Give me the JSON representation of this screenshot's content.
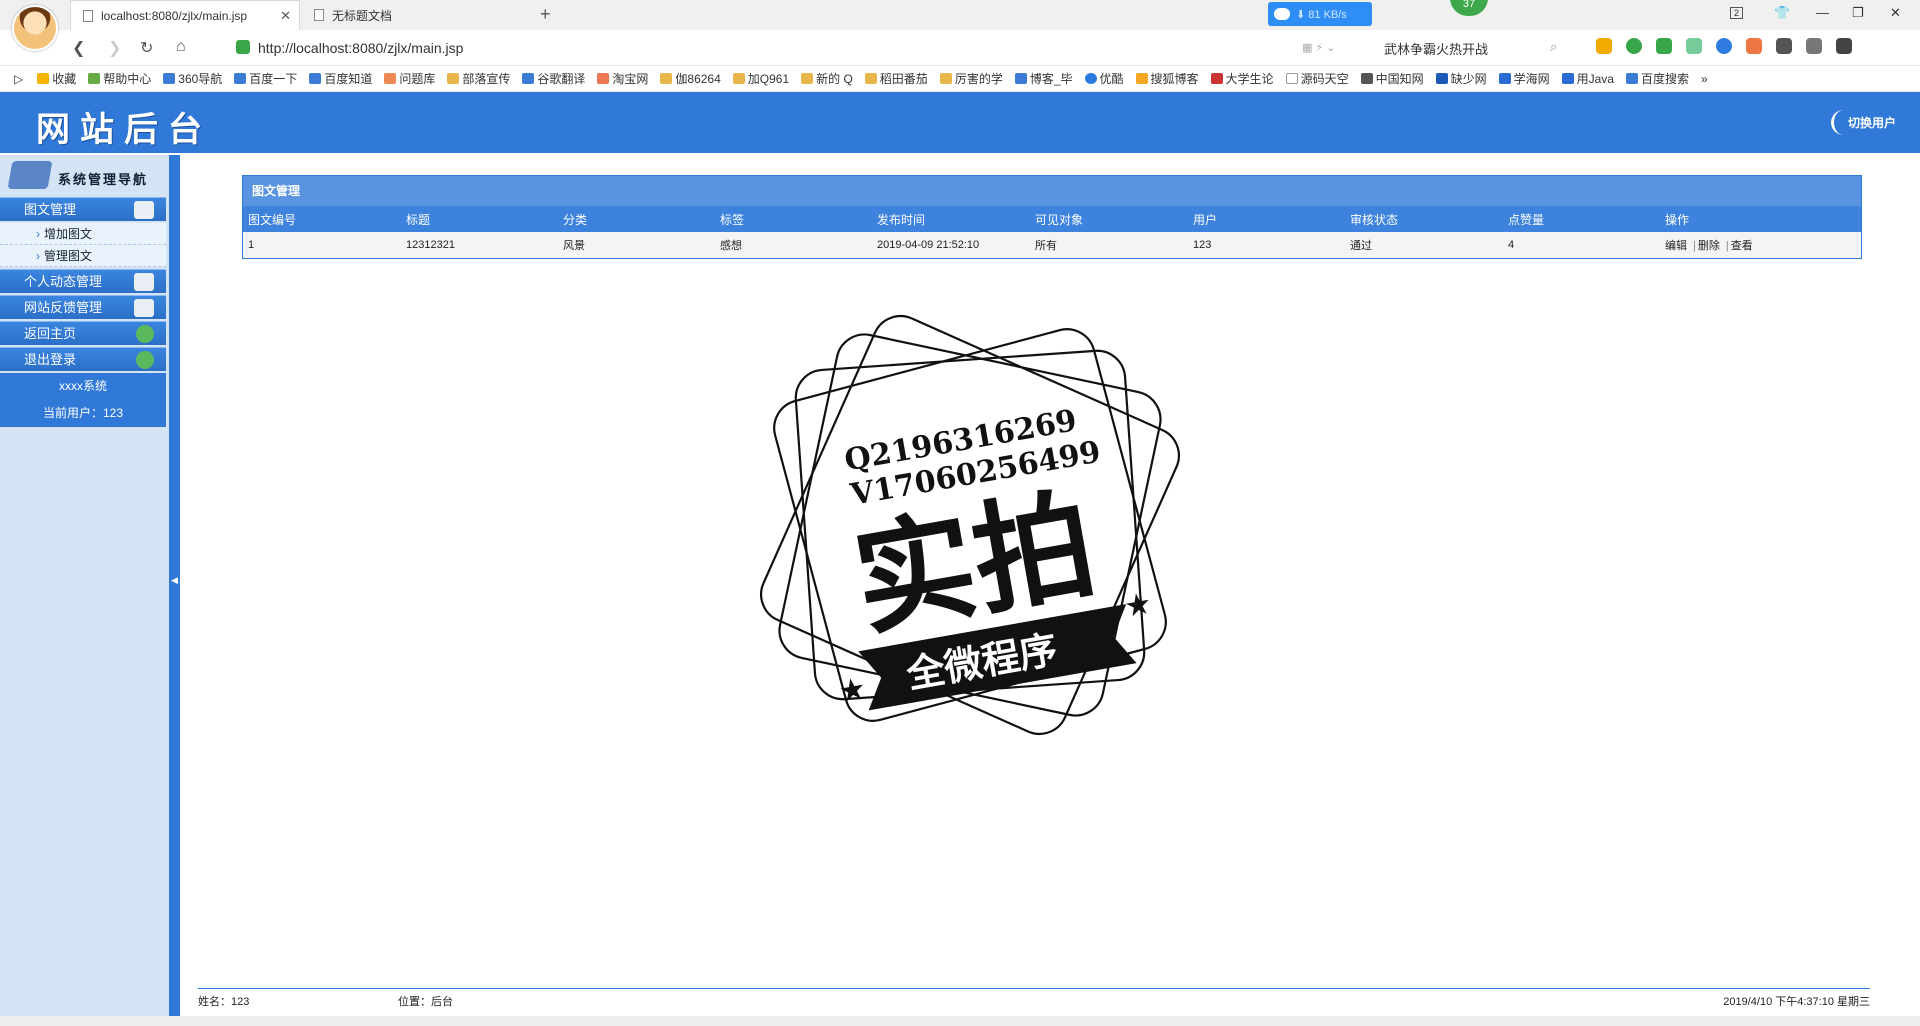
{
  "browser": {
    "tabs": [
      {
        "label": "localhost:8080/zjlx/main.jsp",
        "active": true
      },
      {
        "label": "无标题文档",
        "active": false
      }
    ],
    "download_speed": "81 KB/s",
    "notification_count": "37",
    "window_tab_count": "2",
    "address": "http://localhost:8080/zjlx/main.jsp",
    "search_text": "武林争霸火热开战",
    "bookmarks": [
      "收藏",
      "帮助中心",
      "360导航",
      "百度一下",
      "百度知道",
      "问题库",
      "部落宣传",
      "谷歌翻译",
      "淘宝网",
      "伽86264",
      "加Q961",
      "新的 Q",
      "稻田番茄",
      "厉害的学",
      "博客_毕",
      "优酷",
      "搜狐博客",
      "大学生论",
      "源码天空",
      "中国知网",
      "缺少网",
      "学海网",
      "用Java",
      "百度搜索"
    ]
  },
  "site": {
    "title": "网站后台",
    "switch_user": "切换用户"
  },
  "sidebar": {
    "title": "系统管理导航",
    "menus": [
      {
        "label": "图文管理",
        "icon": "edit-icon",
        "children": [
          "增加图文",
          "管理图文"
        ]
      },
      {
        "label": "个人动态管理",
        "icon": "edit-icon",
        "children": []
      },
      {
        "label": "网站反馈管理",
        "icon": "edit-icon",
        "children": []
      },
      {
        "label": "返回主页",
        "icon": "refresh-arrow-icon",
        "children": []
      },
      {
        "label": "退出登录",
        "icon": "exit-icon",
        "children": []
      }
    ],
    "system_name": "xxxx系统",
    "current_user": "当前用户：123"
  },
  "panel": {
    "title": "图文管理",
    "columns": [
      "图文编号",
      "标题",
      "分类",
      "标签",
      "发布时间",
      "可见对象",
      "用户",
      "审核状态",
      "点赞量",
      "操作"
    ],
    "rows": [
      {
        "id": "1",
        "title": "12312321",
        "category": "风景",
        "tag": "感想",
        "time": "2019-04-09 21:52:10",
        "visible": "所有",
        "user": "123",
        "status": "通过",
        "likes": "4",
        "ops": [
          "编辑",
          "删除",
          "查看"
        ]
      }
    ]
  },
  "stamp": {
    "qq": "Q2196316269",
    "wechat": "V17060256499",
    "main": "实拍",
    "ribbon": "全微程序"
  },
  "footer": {
    "name": "姓名：123",
    "location": "位置：后台",
    "datetime": "2019/4/10 下午4:37:10 星期三"
  },
  "colors": {
    "primary": "#3079d8",
    "sidebar_bg": "#d4e4f5",
    "header_row": "#3d82dc"
  }
}
